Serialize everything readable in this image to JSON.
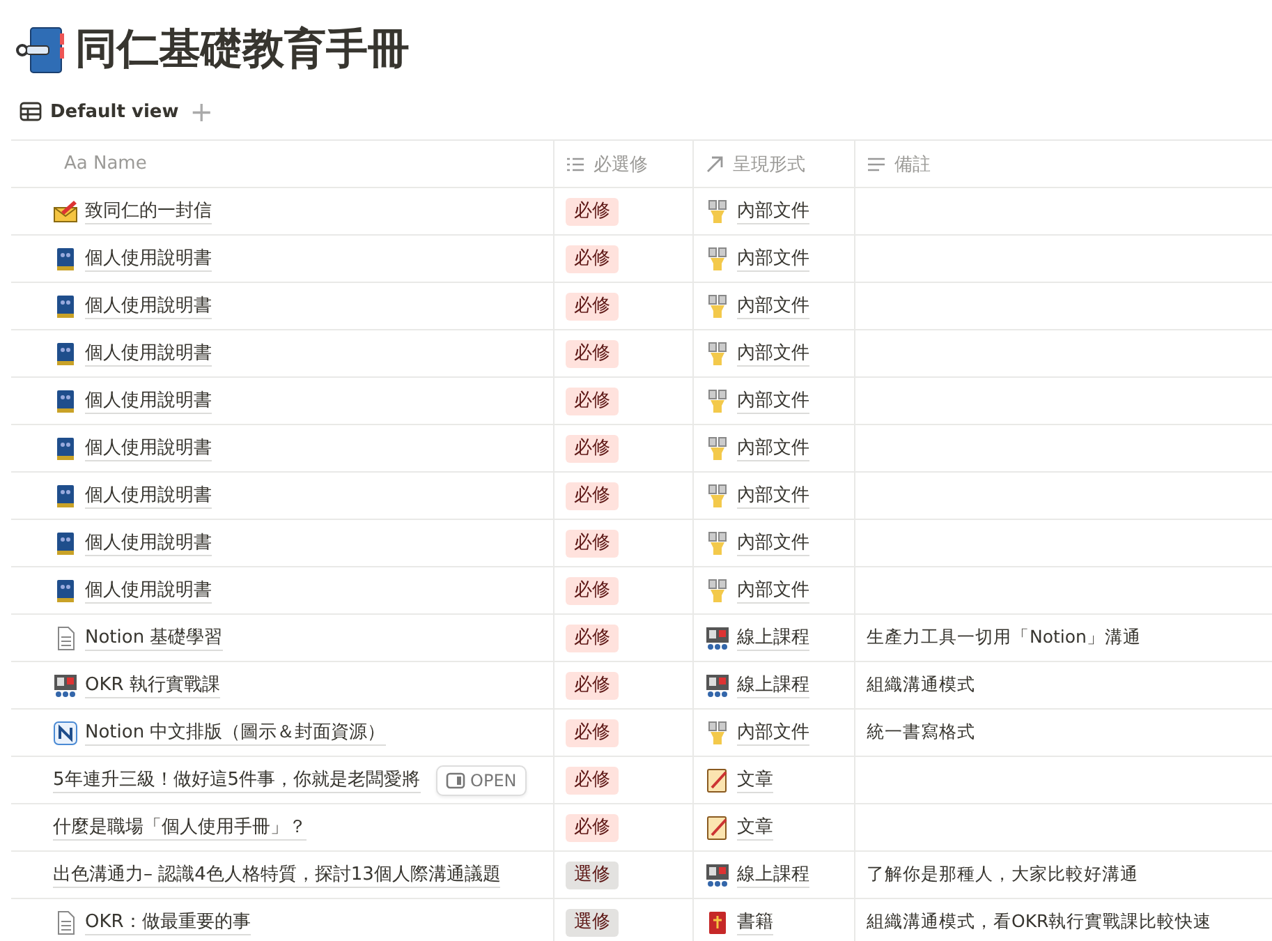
{
  "page": {
    "title": "同仁基礎教育手冊"
  },
  "views": [
    {
      "label": "Default view",
      "selected": true
    }
  ],
  "add_view": "+",
  "table": {
    "columns": [
      {
        "label": "Aa Name",
        "kind": "title"
      },
      {
        "label": "必選修",
        "kind": "select"
      },
      {
        "label": "呈現形式",
        "kind": "relation"
      },
      {
        "label": "備註",
        "kind": "text"
      }
    ],
    "rows": [
      {
        "kind": "envelope",
        "name": "致同仁的一封信",
        "required": {
          "label": "必修",
          "color": "#ffe2dd"
        },
        "format": {
          "kind": "figure",
          "label": "內部文件"
        }
      },
      {
        "kind": "book",
        "name": "個人使用說明書",
        "required": {
          "label": "必修",
          "color": "#ffe2dd"
        },
        "format": {
          "kind": "figure",
          "label": "內部文件"
        }
      },
      {
        "kind": "book",
        "name": "個人使用說明書",
        "required": {
          "label": "必修",
          "color": "#ffe2dd"
        },
        "format": {
          "kind": "figure",
          "label": "內部文件"
        }
      },
      {
        "kind": "book",
        "name": "個人使用說明書",
        "required": {
          "label": "必修",
          "color": "#ffe2dd"
        },
        "format": {
          "kind": "figure",
          "label": "內部文件"
        }
      },
      {
        "kind": "book",
        "name": "個人使用說明書",
        "required": {
          "label": "必修",
          "color": "#ffe2dd"
        },
        "format": {
          "kind": "figure",
          "label": "內部文件"
        }
      },
      {
        "kind": "book",
        "name": "個人使用說明書",
        "required": {
          "label": "必修",
          "color": "#ffe2dd"
        },
        "format": {
          "kind": "figure",
          "label": "內部文件"
        }
      },
      {
        "kind": "book",
        "name": "個人使用說明書",
        "required": {
          "label": "必修",
          "color": "#ffe2dd"
        },
        "format": {
          "kind": "figure",
          "label": "內部文件"
        }
      },
      {
        "kind": "book",
        "name": "個人使用說明書",
        "required": {
          "label": "必修",
          "color": "#ffe2dd"
        },
        "format": {
          "kind": "figure",
          "label": "內部文件"
        }
      },
      {
        "kind": "book",
        "name": "個人使用說明書",
        "required": {
          "label": "必修",
          "color": "#ffe2dd"
        },
        "format": {
          "kind": "figure",
          "label": "內部文件"
        }
      },
      {
        "kind": "page",
        "name": "Notion 基礎學習",
        "required": {
          "label": "必修",
          "color": "#ffe2dd"
        },
        "format": {
          "kind": "classroom",
          "label": "線上課程"
        },
        "note": "生產力工具一切用「Notion」溝通"
      },
      {
        "kind": "classroom",
        "name": "OKR 執行實戰課",
        "required": {
          "label": "必修",
          "color": "#ffe2dd"
        },
        "format": {
          "kind": "classroom",
          "label": "線上課程"
        },
        "note": "組織溝通模式"
      },
      {
        "kind": "notion",
        "name": "Notion 中文排版（圖示＆封面資源）",
        "required": {
          "label": "必修",
          "color": "#ffe2dd"
        },
        "format": {
          "kind": "figure",
          "label": "內部文件"
        },
        "note": "統一書寫格式"
      },
      {
        "kind": "plain",
        "name": "5年連升三級！做好這5件事，你就是老闆愛將",
        "open_button": "OPEN",
        "required": {
          "label": "必修",
          "color": "#ffe2dd"
        },
        "format": {
          "kind": "notepad",
          "label": "文章"
        }
      },
      {
        "kind": "plain",
        "name": "什麼是職場「個人使用手冊」？",
        "required": {
          "label": "必修",
          "color": "#ffe2dd"
        },
        "format": {
          "kind": "notepad",
          "label": "文章"
        }
      },
      {
        "kind": "plain",
        "name": "出色溝通力– 認識4色人格特質，探討13個人際溝通議題",
        "required": {
          "label": "選修",
          "color": "#e3e2e0"
        },
        "format": {
          "kind": "classroom",
          "label": "線上課程"
        },
        "note": "了解你是那種人，大家比較好溝通"
      },
      {
        "kind": "page",
        "name": "OKR：做最重要的事",
        "required": {
          "label": "選修",
          "color": "#e3e2e0"
        },
        "format": {
          "kind": "redbook",
          "label": "書籍"
        },
        "note": "組織溝通模式，看OKR執行實戰課比較快速"
      }
    ]
  }
}
